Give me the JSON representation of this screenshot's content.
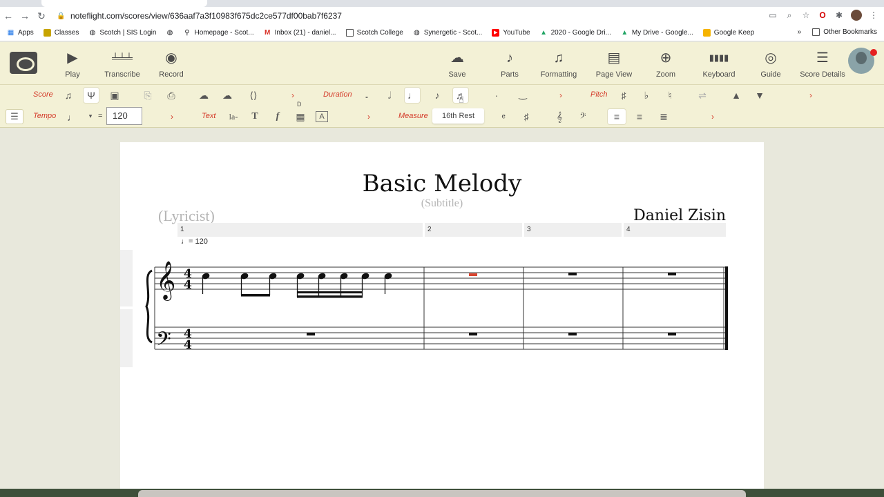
{
  "browser": {
    "url": "noteflight.com/scores/view/636aaf7a3f10983f675dc2ce577df00bab7f6237"
  },
  "bookmarks": {
    "items": [
      {
        "label": "Apps",
        "icon": "apps-grid-icon"
      },
      {
        "label": "Classes",
        "icon": "folder-icon"
      },
      {
        "label": "Scotch | SIS Login",
        "icon": "globe-icon"
      },
      {
        "label": "",
        "icon": "globe-icon"
      },
      {
        "label": "Homepage - Scot...",
        "icon": "bookmark-icon"
      },
      {
        "label": "Inbox (21) - daniel...",
        "icon": "gmail-icon"
      },
      {
        "label": "Scotch College",
        "icon": "folder-icon"
      },
      {
        "label": "Synergetic - Scot...",
        "icon": "globe-icon"
      },
      {
        "label": "YouTube",
        "icon": "youtube-icon"
      },
      {
        "label": "2020 - Google Dri...",
        "icon": "drive-icon"
      },
      {
        "label": "My Drive - Google...",
        "icon": "drive-icon"
      },
      {
        "label": "Google Keep",
        "icon": "keep-icon"
      }
    ],
    "more": "»",
    "other": "Other Bookmarks"
  },
  "toolbar": {
    "play": "Play",
    "transcribe": "Transcribe",
    "record": "Record",
    "save": "Save",
    "parts": "Parts",
    "formatting": "Formatting",
    "page_view": "Page View",
    "zoom": "Zoom",
    "keyboard": "Keyboard",
    "guide": "Guide",
    "score_details": "Score Details"
  },
  "palette": {
    "score": "Score",
    "duration": "Duration",
    "pitch": "Pitch",
    "tempo": "Tempo",
    "tempo_value": "120",
    "tempo_equals": "=",
    "text": "Text",
    "lyric_icon_text": "la-",
    "text_icon": "T",
    "dynamic_icon": "f",
    "chord_letter": "D",
    "rehearsal_icon": "A",
    "measure": "Measure",
    "tooltip": "16th Rest"
  },
  "score": {
    "title": "Basic Melody",
    "subtitle": "(Subtitle)",
    "lyricist": "(Lyricist)",
    "composer": "Daniel Zisin",
    "measures": [
      "1",
      "2",
      "3",
      "4"
    ],
    "tempo_mark": "= 120",
    "time_signature": [
      "4",
      "4"
    ]
  },
  "colors": {
    "accent_red": "#d43b2a",
    "toolbar_bg": "#f3f1d6",
    "selected_rest": "#d9442f"
  }
}
